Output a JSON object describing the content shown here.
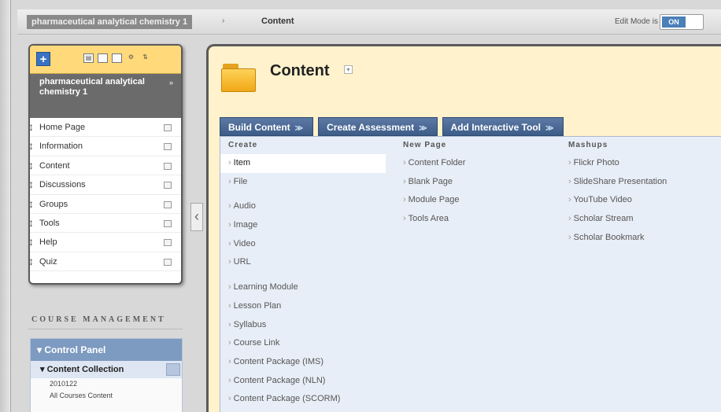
{
  "topbar": {
    "course_crumb": "pharmaceutical analytical chemistry 1",
    "separator": "›",
    "page_crumb": "Content",
    "edit_mode_label": "Edit Mode is",
    "edit_mode_value": "ON"
  },
  "course_menu": {
    "add_button": "+",
    "course_title": "pharmaceutical analytical chemistry 1",
    "title_arrow": "»",
    "items": [
      {
        "label": "Home Page"
      },
      {
        "label": "Information"
      },
      {
        "label": "Content"
      },
      {
        "label": "Discussions"
      },
      {
        "label": "Groups"
      },
      {
        "label": "Tools"
      },
      {
        "label": "Help"
      },
      {
        "label": "Quiz"
      }
    ]
  },
  "collapse_handle": "‹",
  "course_management": {
    "title": "COURSE MANAGEMENT",
    "control_panel": "Control Panel",
    "content_collection": "Content Collection",
    "sub_items": [
      "2010122",
      "All Courses Content"
    ]
  },
  "main": {
    "title": "Content",
    "buttons": [
      {
        "label": "Build Content"
      },
      {
        "label": "Create Assessment"
      },
      {
        "label": "Add Interactive Tool"
      }
    ],
    "menu_columns": {
      "create": {
        "heading": "Create",
        "items": [
          "Item",
          "File",
          "Audio",
          "Image",
          "Video",
          "URL",
          "Learning Module",
          "Lesson Plan",
          "Syllabus",
          "Course Link",
          "Content Package (IMS)",
          "Content Package (NLN)",
          "Content Package (SCORM)"
        ]
      },
      "new_page": {
        "heading": "New Page",
        "items": [
          "Content Folder",
          "Blank Page",
          "Module Page",
          "Tools Area"
        ]
      },
      "mashups": {
        "heading": "Mashups",
        "items": [
          "Flickr Photo",
          "SlideShare Presentation",
          "YouTube Video",
          "Scholar Stream",
          "Scholar Bookmark"
        ]
      }
    }
  },
  "colors": {
    "header_blue": "#3d5c88",
    "menu_bg": "#e8eef7",
    "content_bg": "#fff2cc",
    "toolbar_yellow": "#ffd97a"
  }
}
